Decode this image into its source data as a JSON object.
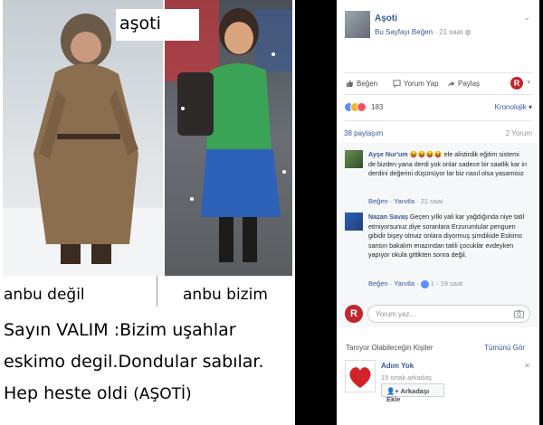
{
  "meme": {
    "title": "aşoti",
    "caption_left": "anbu değil",
    "caption_right": "anbu bizim",
    "text_lines": [
      "Sayın VALIM  :Bizim uşahlar",
      "eskimo degil.Dondular sabılar.",
      "Hep heste oldi"
    ],
    "signature": "(AŞOTİ)"
  },
  "post": {
    "page_name": "Aşoti",
    "like_page": "Bu Sayfayı Beğen",
    "time": "21 saat",
    "actions": {
      "like": "Beğen",
      "comment": "Yorum Yap",
      "share": "Paylaş"
    },
    "reaction_count": "183",
    "sort": "Kronolojik",
    "shares": "38 paylaşım",
    "comments_count": "2 Yorum"
  },
  "comments": [
    {
      "name": "Ayşe Nur'um",
      "emojis": "😝😝😝😝",
      "text": "ele alistirdik eğitim sistemi de bizden yana derdi yok onlar sadece bir saatlik kar in derdini değerini düşünüyor lar biz nasıl olsa yasamisiz",
      "like": "Beğen",
      "reply": "Yanıtla",
      "time": "21 saat"
    },
    {
      "name": "Nazan Savaş",
      "text": "Geçen yılki vali kar yağdığında niye tatil etmiyorsunuz diye soranlara Erzurumlular penguen gibidir bişey olmaz onlara diyormuş şimdikide Eskimo sansın bakalım enazından tatili çocuklar evdeyken yapıyor okula gittikten sonra değil.",
      "like": "Beğen",
      "reply": "Yanıtla",
      "likes": "1",
      "time": "19 saat"
    }
  ],
  "write_comment": {
    "placeholder": "Yorum yaz..."
  },
  "pymk": {
    "title": "Tanıyor Olabileceğin Kişiler",
    "see_all": "Tümünü Gör",
    "name": "Adım Yok",
    "mutual": "15 ortak arkadaş",
    "add_button": "Arkadaşı Ekle"
  },
  "colors": {
    "link": "#365899",
    "meta": "#90949c",
    "brand_red": "#c0262d",
    "like_blue": "#5890ff"
  }
}
